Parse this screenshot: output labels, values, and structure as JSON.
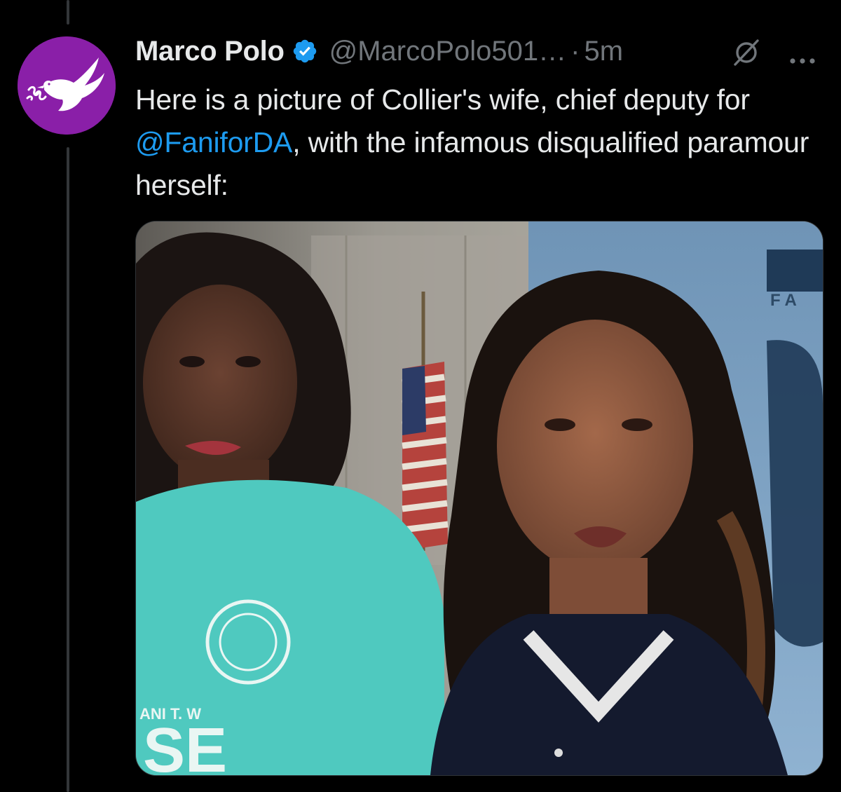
{
  "tweet": {
    "author": {
      "display_name": "Marco Polo",
      "handle": "@MarcoPolo501…",
      "verified": true,
      "avatar_icon": "dove-with-branch-icon",
      "avatar_color": "#8a1fa8"
    },
    "separator": "·",
    "timestamp": "5m",
    "text_before_mention": "Here is a picture of Collier's wife, chief deputy for ",
    "mention": "@FaniforDA",
    "text_after_mention": ", with the infamous disqualified paramour herself:",
    "media": {
      "kind": "photo",
      "visible_text": {
        "banner_letters": "F A",
        "shirt_letters": "ANI T. W",
        "shirt_logo_text": "SE"
      }
    },
    "actions": {
      "grok_icon": "grok-icon",
      "more_icon": "more-dots-icon"
    }
  },
  "colors": {
    "background": "#000000",
    "text_primary": "#e7e9ea",
    "text_secondary": "#71767b",
    "link": "#1d9bf0",
    "verified_badge": "#1d9bf0",
    "thread_line": "#333639"
  }
}
